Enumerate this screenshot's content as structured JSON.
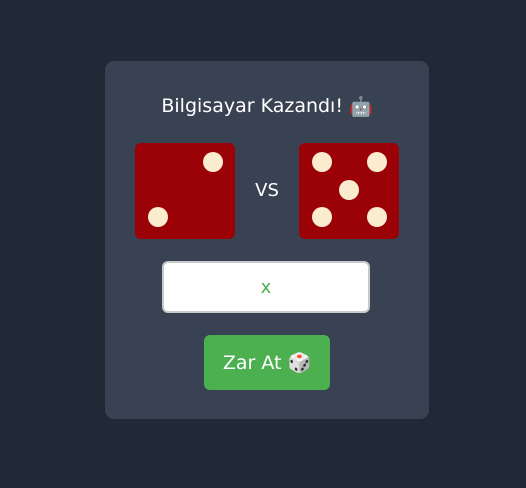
{
  "game": {
    "result_text": "Bilgisayar Kazandı!",
    "result_icon": "🤖",
    "vs_label": "VS",
    "player_die_value": 2,
    "computer_die_value": 5,
    "die_color": "#9b0207",
    "pip_color": "#fbeccf"
  },
  "guess_input": {
    "value": "x"
  },
  "roll_button": {
    "label": "Zar At",
    "icon": "🎲",
    "color": "#4caf50"
  }
}
